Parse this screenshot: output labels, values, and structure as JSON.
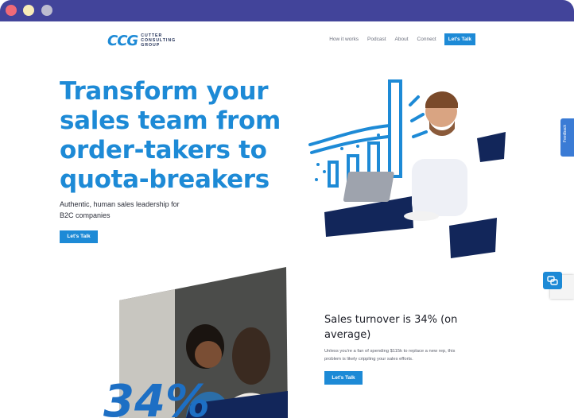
{
  "window": {
    "controls": [
      "close-dot",
      "minimize-dot",
      "maximize-dot"
    ]
  },
  "header": {
    "logo_mark": "CCG",
    "logo_lines": [
      "CUTTER",
      "CONSULTING",
      "GROUP"
    ],
    "nav": [
      "How it works",
      "Podcast",
      "About",
      "Connect"
    ],
    "cta": "Let's Talk"
  },
  "hero": {
    "title": "Transform your sales team from order-takers to quota-breakers",
    "subtitle": "Authentic, human sales leadership for B2C companies",
    "cta": "Let's Talk"
  },
  "sidebar_widgets": {
    "feedback": "Feedback"
  },
  "section2": {
    "stat_overlay": "34%",
    "title": "Sales turnover is 34% (on average)",
    "body": "Unless you're a fan of spending $115k to replace a new rep, this problem is likely crippling your sales efforts.",
    "cta": "Let's Talk"
  },
  "colors": {
    "brand_blue": "#1d8ad6",
    "navy": "#12265a",
    "chrome": "#42449a"
  }
}
